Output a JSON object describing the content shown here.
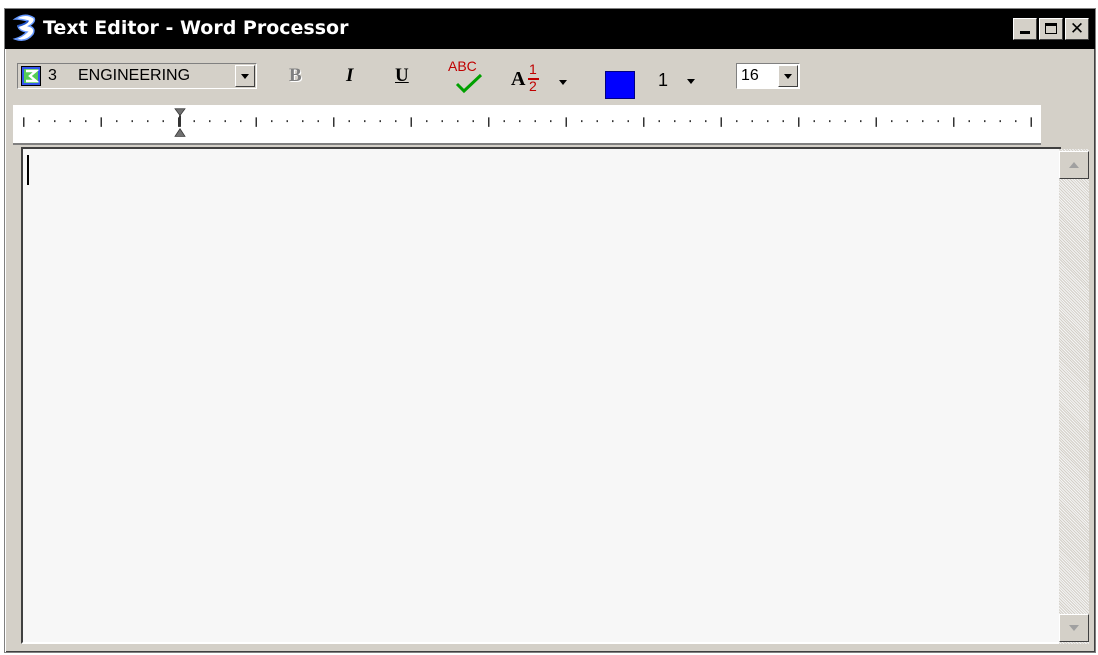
{
  "window": {
    "title": "Text Editor - Word Processor",
    "icons": {
      "app": "microstation-logo-icon",
      "minimize": "minimize-icon",
      "maximize": "maximize-icon",
      "close": "close-icon"
    },
    "close_glyph": "✕"
  },
  "toolbar": {
    "font": {
      "number": "3",
      "name": "ENGINEERING",
      "icon": "font-type-icon"
    },
    "bold_label": "B",
    "italic_label": "I",
    "underline_label": "U",
    "spell_check": {
      "label": "ABC",
      "icon": "spell-check-icon"
    },
    "stacked_fraction": {
      "letter": "A",
      "numerator": "1",
      "denominator": "2"
    },
    "color": "#0000ff",
    "line_weight": "1",
    "text_size": "16"
  },
  "ruler": {
    "icon": "indent-marker-icon"
  },
  "editor": {
    "content": "",
    "background": "#f7f7f7"
  },
  "colors": {
    "title_bar": "#000000",
    "chrome": "#d4d0c8",
    "accent_red": "#c00000",
    "check_green": "#00a000"
  }
}
